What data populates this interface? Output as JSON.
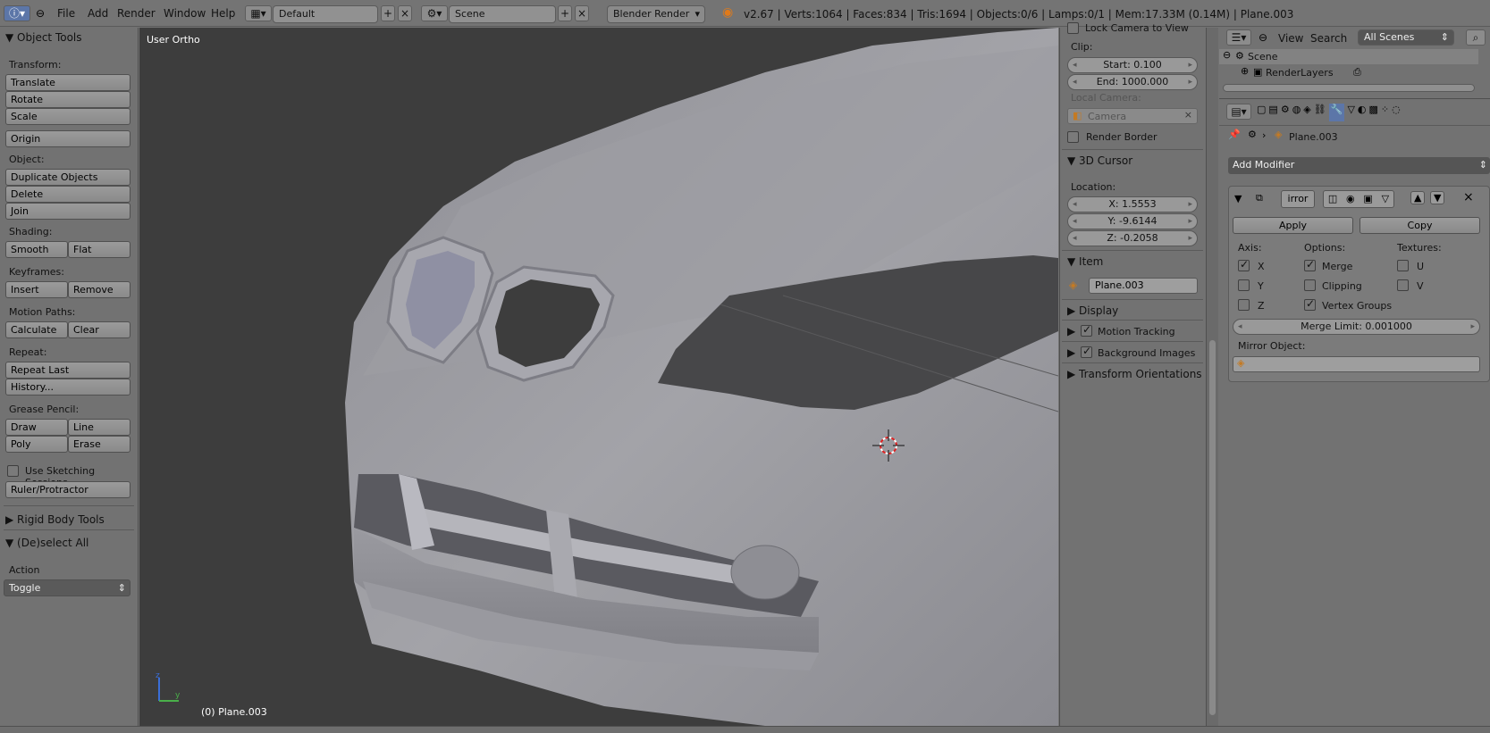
{
  "topbar": {
    "menus": [
      "File",
      "Add",
      "Render",
      "Window",
      "Help"
    ],
    "layout": "Default",
    "scene": "Scene",
    "engine": "Blender Render",
    "status": "v2.67 | Verts:1064 | Faces:834 | Tris:1694 | Objects:0/6 | Lamps:0/1 | Mem:17.33M (0.14M) | Plane.003"
  },
  "tools": {
    "header": "Object Tools",
    "transform_label": "Transform:",
    "translate": "Translate",
    "rotate": "Rotate",
    "scale": "Scale",
    "origin": "Origin",
    "object_label": "Object:",
    "duplicate": "Duplicate Objects",
    "delete": "Delete",
    "join": "Join",
    "shading_label": "Shading:",
    "smooth": "Smooth",
    "flat": "Flat",
    "keyframes_label": "Keyframes:",
    "insert": "Insert",
    "remove": "Remove",
    "motion_label": "Motion Paths:",
    "calculate": "Calculate",
    "clear": "Clear",
    "repeat_label": "Repeat:",
    "repeat_last": "Repeat Last",
    "history": "History...",
    "grease_label": "Grease Pencil:",
    "draw": "Draw",
    "line": "Line",
    "poly": "Poly",
    "erase": "Erase",
    "sketching": "Use Sketching Sessions",
    "ruler": "Ruler/Protractor",
    "rigid": "Rigid Body Tools",
    "deselect": "(De)select All",
    "action_label": "Action",
    "action_value": "Toggle"
  },
  "viewport": {
    "view_name": "User Ortho",
    "object_label": "(0) Plane.003"
  },
  "npanel": {
    "lock_camera": "Lock Camera to View",
    "clip_label": "Clip:",
    "clip_start": "Start: 0.100",
    "clip_end": "End: 1000.000",
    "local_camera_label": "Local Camera:",
    "camera_value": "Camera",
    "render_border": "Render Border",
    "cursor_header": "3D Cursor",
    "location_label": "Location:",
    "cx": "X: 1.5553",
    "cy": "Y: -9.6144",
    "cz": "Z: -0.2058",
    "item_header": "Item",
    "item_name": "Plane.003",
    "display": "Display",
    "motion_tracking": "Motion Tracking",
    "background_images": "Background Images",
    "transform_orientations": "Transform Orientations"
  },
  "outliner": {
    "view": "View",
    "search": "Search",
    "scenes": "All Scenes",
    "scene": "Scene",
    "render_layers": "RenderLayers"
  },
  "props": {
    "breadcrumb": "Plane.003",
    "add_modifier": "Add Modifier",
    "modifier_name": "irror",
    "apply": "Apply",
    "copy": "Copy",
    "axis_label": "Axis:",
    "options_label": "Options:",
    "textures_label": "Textures:",
    "x": "X",
    "y": "Y",
    "z": "Z",
    "merge": "Merge",
    "clipping": "Clipping",
    "vertex_groups": "Vertex Groups",
    "u": "U",
    "v": "V",
    "merge_limit": "Merge Limit: 0.001000",
    "mirror_object": "Mirror Object:"
  }
}
